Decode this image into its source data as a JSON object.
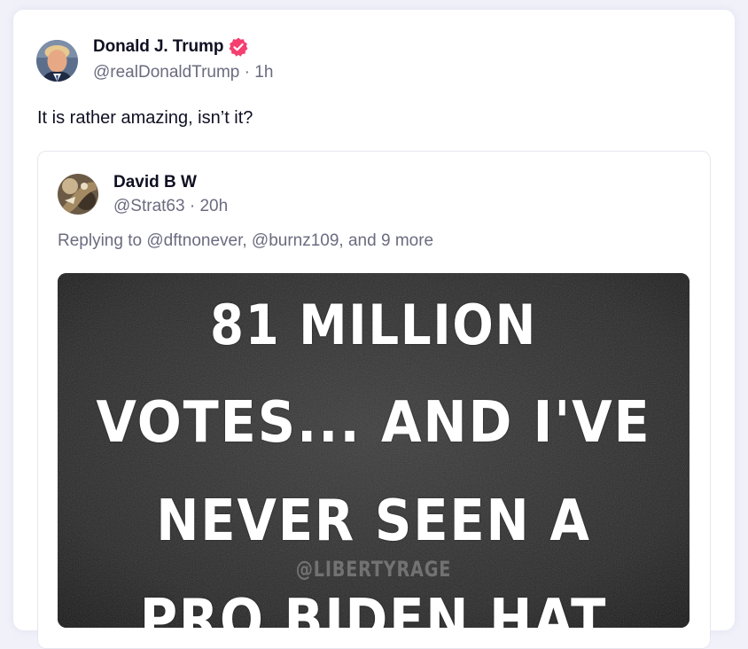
{
  "post": {
    "author_name": "Donald J. Trump",
    "author_handle": "@realDonaldTrump",
    "separator": "·",
    "timestamp": "1h",
    "text": "It is rather amazing, isn’t it?"
  },
  "quote": {
    "author_name": "David B W",
    "author_handle": "@Strat63",
    "separator": "·",
    "timestamp": "20h",
    "replying_to": "Replying to @dftnonever, @burnz109, and 9 more",
    "image": {
      "line1": "81 MILLION",
      "line2": "VOTES... AND I'VE",
      "line3": "NEVER SEEN A",
      "line4": "PRO BIDEN HAT",
      "watermark": "@LIBERTYRAGE"
    }
  },
  "colors": {
    "verified_badge": "#f43f6f",
    "text_primary": "#0f0f23",
    "text_secondary": "#6b6b80",
    "background": "#f1f1fa"
  },
  "icons": {
    "verified": "verified-badge-icon"
  }
}
